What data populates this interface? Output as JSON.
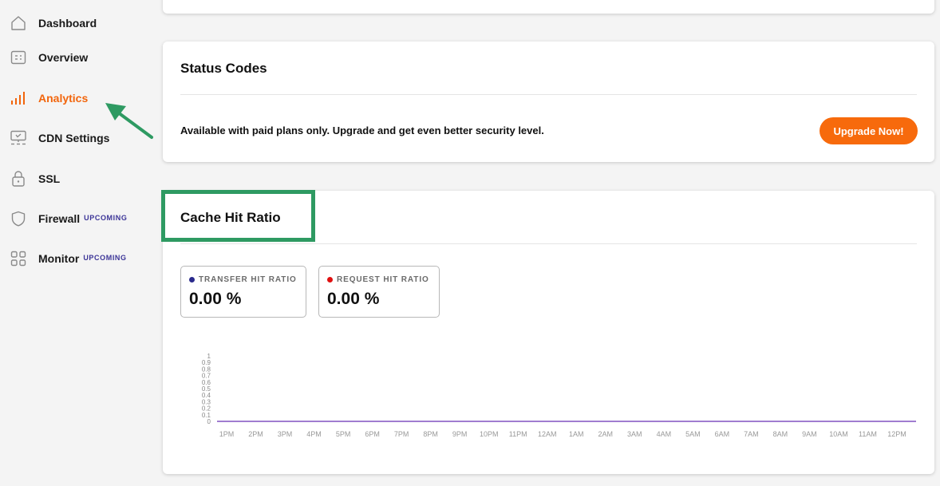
{
  "sidebar": {
    "items": [
      {
        "label": "Dashboard",
        "icon": "home-icon"
      },
      {
        "label": "Overview",
        "icon": "overview-icon"
      },
      {
        "label": "Analytics",
        "icon": "analytics-icon",
        "active": true
      },
      {
        "label": "CDN Settings",
        "icon": "cdn-icon"
      },
      {
        "label": "SSL",
        "icon": "lock-icon"
      },
      {
        "label": "Firewall",
        "icon": "shield-icon",
        "badge": "UPCOMING"
      },
      {
        "label": "Monitor",
        "icon": "grid-icon",
        "badge": "UPCOMING"
      }
    ]
  },
  "status_codes": {
    "title": "Status Codes",
    "message": "Available with paid plans only. Upgrade and get even better security level.",
    "button": "Upgrade Now!"
  },
  "cache_hit_ratio": {
    "title": "Cache Hit Ratio",
    "stats": [
      {
        "label": "TRANSFER HIT RATIO",
        "value": "0.00 %",
        "dot_color": "#2a2a8c"
      },
      {
        "label": "REQUEST HIT RATIO",
        "value": "0.00 %",
        "dot_color": "#e01010"
      }
    ]
  },
  "colors": {
    "accent": "#f2650c",
    "annotation": "#2e9a62",
    "line": "#a07cd0"
  },
  "chart_data": {
    "type": "line",
    "x": [
      "1PM",
      "2PM",
      "3PM",
      "4PM",
      "5PM",
      "6PM",
      "7PM",
      "8PM",
      "9PM",
      "10PM",
      "11PM",
      "12AM",
      "1AM",
      "2AM",
      "3AM",
      "4AM",
      "5AM",
      "6AM",
      "7AM",
      "8AM",
      "9AM",
      "10AM",
      "11AM",
      "12PM"
    ],
    "y_ticks": [
      "0",
      "0.1",
      "0.2",
      "0.3",
      "0.4",
      "0.5",
      "0.6",
      "0.7",
      "0.8",
      "0.9",
      "1"
    ],
    "series": [
      {
        "values": [
          0,
          0,
          0,
          0,
          0,
          0,
          0,
          0,
          0,
          0,
          0,
          0,
          0,
          0,
          0,
          0,
          0,
          0,
          0,
          0,
          0,
          0,
          0,
          0
        ]
      }
    ],
    "ylim": [
      0,
      1
    ],
    "grid": false
  }
}
